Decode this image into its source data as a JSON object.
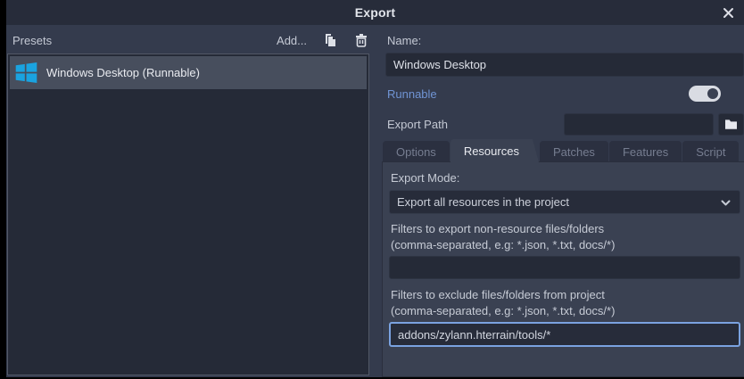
{
  "window": {
    "title": "Export"
  },
  "presets": {
    "label": "Presets",
    "add_button": "Add...",
    "items": [
      {
        "name": "Windows Desktop (Runnable)",
        "selected": true
      }
    ]
  },
  "form": {
    "name_label": "Name:",
    "name_value": "Windows Desktop",
    "runnable_label": "Runnable",
    "runnable_on": true,
    "export_path_label": "Export Path",
    "export_path_value": ""
  },
  "tabs": {
    "options": "Options",
    "resources": "Resources",
    "patches": "Patches",
    "features": "Features",
    "script": "Script",
    "active_tab": "Resources"
  },
  "resources_tab": {
    "export_mode_label": "Export Mode:",
    "export_mode_value": "Export all resources in the project",
    "include_filters_label": "Filters to export non-resource files/folders",
    "include_filters_hint": "(comma-separated, e.g: *.json, *.txt, docs/*)",
    "include_filters_value": "",
    "exclude_filters_label": "Filters to exclude files/folders from project",
    "exclude_filters_hint": "(comma-separated, e.g: *.json, *.txt, docs/*)",
    "exclude_filters_value": "addons/zylann.hterrain/tools/*"
  },
  "colors": {
    "titlebar_bg": "#272c3a",
    "dialog_bg": "#343b4d",
    "panel_bg": "#3a4152",
    "field_bg": "#252a37",
    "selected_row_bg": "#474e5d",
    "accent_blue": "#7094d4",
    "focus_border": "#7aa2e0",
    "windows_logo_blue": "#1aa3e0"
  }
}
